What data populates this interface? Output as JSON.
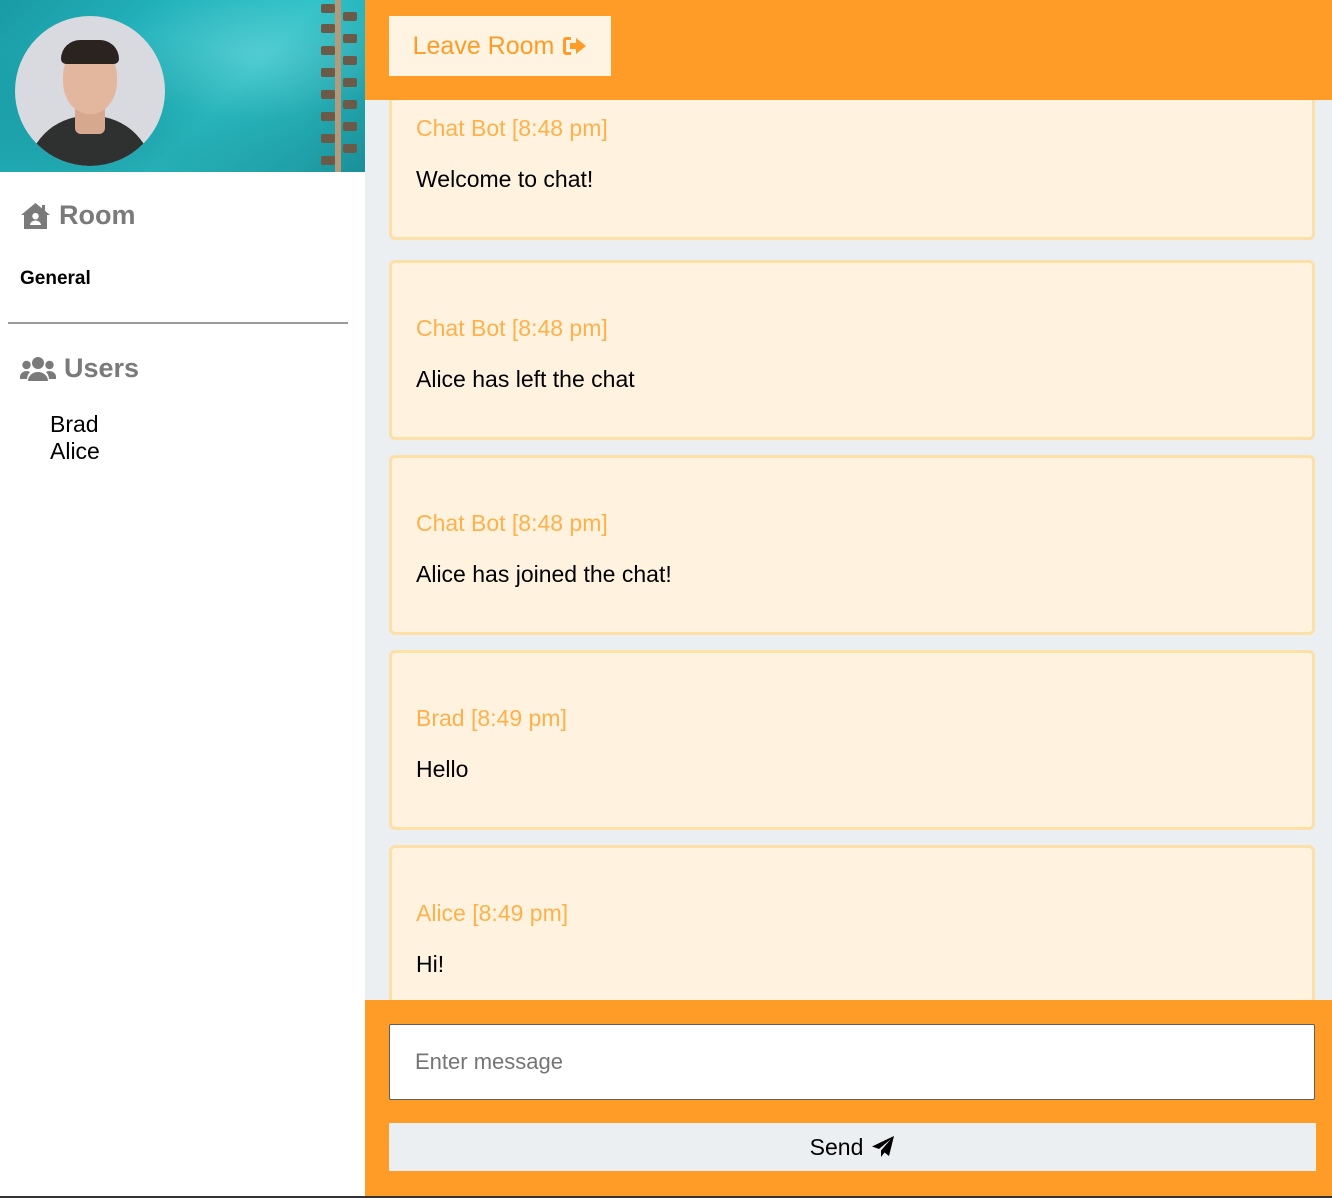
{
  "header": {
    "leave_label": "Leave Room",
    "leave_icon": "sign-out-icon"
  },
  "sidebar": {
    "room_title": "Room",
    "room_icon": "house-user-icon",
    "room_name": "General",
    "users_title": "Users",
    "users_icon": "users-icon",
    "users": [
      "Brad",
      "Alice"
    ]
  },
  "messages": [
    {
      "user": "Chat Bot",
      "time": "[8:48 pm]",
      "meta": "Chat Bot [8:48 pm]",
      "text": "Welcome to chat!"
    },
    {
      "user": "Chat Bot",
      "time": "[8:48 pm]",
      "meta": "Chat Bot [8:48 pm]",
      "text": "Alice has left the chat"
    },
    {
      "user": "Chat Bot",
      "time": "[8:48 pm]",
      "meta": "Chat Bot [8:48 pm]",
      "text": "Alice has joined the chat!"
    },
    {
      "user": "Brad",
      "time": "[8:49 pm]",
      "meta": "Brad [8:49 pm]",
      "text": "Hello"
    },
    {
      "user": "Alice",
      "time": "[8:49 pm]",
      "meta": "Alice [8:49 pm]",
      "text": "Hi!"
    }
  ],
  "composer": {
    "placeholder": "Enter message",
    "value": "",
    "send_label": "Send",
    "send_icon": "paper-plane-icon"
  },
  "colors": {
    "accent": "#ff9b27",
    "message_bg": "#fff3df",
    "message_meta": "#fdb14c",
    "section_gray": "#7a7a7a"
  }
}
